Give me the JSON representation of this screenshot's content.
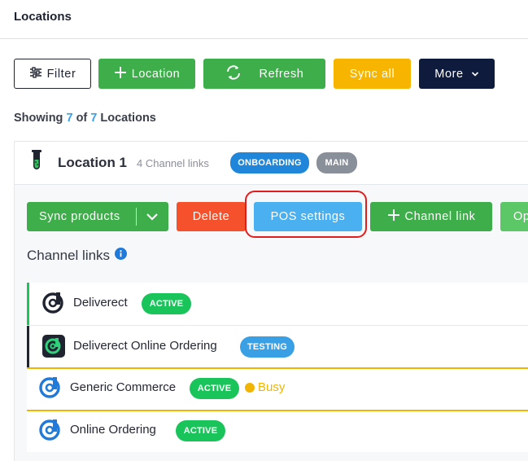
{
  "header": {
    "title": "Locations"
  },
  "toolbar": {
    "filter_label": "Filter",
    "location_label": "Location",
    "refresh_label": "Refresh",
    "sync_all_label": "Sync all",
    "more_label": "More"
  },
  "summary": {
    "prefix": "Showing",
    "shown": "7",
    "of": "of",
    "total": "7",
    "suffix": "Locations"
  },
  "location": {
    "name": "Location 1",
    "channel_links_count": "4 Channel links",
    "badges": [
      "ONBOARDING",
      "MAIN"
    ],
    "actions": {
      "sync_products": "Sync products",
      "delete": "Delete",
      "pos_settings": "POS settings",
      "channel_link": "Channel link",
      "partial_next": "Op"
    },
    "channel_links_title": "Channel links",
    "channels": [
      {
        "name": "Deliverect",
        "status": "ACTIVE",
        "accent": "#19c45a"
      },
      {
        "name": "Deliverect Online Ordering",
        "status": "TESTING",
        "accent": "#1f2430"
      },
      {
        "name": "Generic Commerce",
        "status": "ACTIVE",
        "extra": "Busy",
        "accent": "#f1b400"
      },
      {
        "name": "Online Ordering",
        "status": "ACTIVE",
        "accent": "#f1b400"
      }
    ]
  },
  "colors": {
    "green": "#3dae49",
    "yellow": "#f7b500",
    "navy": "#0f1b3d",
    "red": "#f4512c",
    "blue": "#4ab0ef",
    "highlight": "#e21d1d"
  },
  "icons": [
    "sliders-icon",
    "plus-icon",
    "refresh-icon",
    "chevron-down-icon",
    "test-tube-icon",
    "info-icon",
    "deliverect-logo-icon"
  ]
}
